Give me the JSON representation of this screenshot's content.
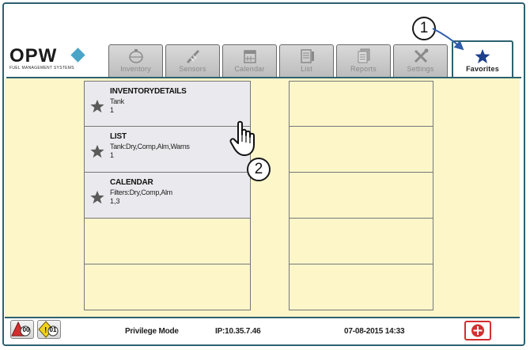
{
  "brand": {
    "name": "OPW",
    "tagline": "FUEL MANAGEMENT SYSTEMS"
  },
  "tabs": [
    {
      "label": "Inventory",
      "icon": "tank-icon"
    },
    {
      "label": "Sensors",
      "icon": "probe-icon"
    },
    {
      "label": "Calendar",
      "icon": "calendar-icon"
    },
    {
      "label": "List",
      "icon": "list-icon"
    },
    {
      "label": "Reports",
      "icon": "reports-icon"
    },
    {
      "label": "Settings",
      "icon": "wrench-screwdriver-icon"
    },
    {
      "label": "Favorites",
      "icon": "star-icon",
      "active": true
    }
  ],
  "favorites": [
    {
      "title": "INVENTORYDETAILS",
      "line1": "Tank",
      "line2": "1"
    },
    {
      "title": "LIST",
      "line1": "Tank:Dry,Comp,Alm,Warns",
      "line2": "1"
    },
    {
      "title": "CALENDAR",
      "line1": "Filters:Dry,Comp,Alm",
      "line2": "1,3"
    }
  ],
  "callouts": {
    "one": "1",
    "two": "2"
  },
  "footer": {
    "alarm_count": "00",
    "warning_count": "01",
    "mode": "Privilege Mode",
    "ip": "IP:10.35.7.46",
    "datetime": "07-08-2015 14:33"
  },
  "colors": {
    "frame": "#2d6170",
    "background": "#fcf6c9",
    "alarm": "#d32f2f",
    "warning": "#f2d21b",
    "accent": "#2f5cab"
  }
}
